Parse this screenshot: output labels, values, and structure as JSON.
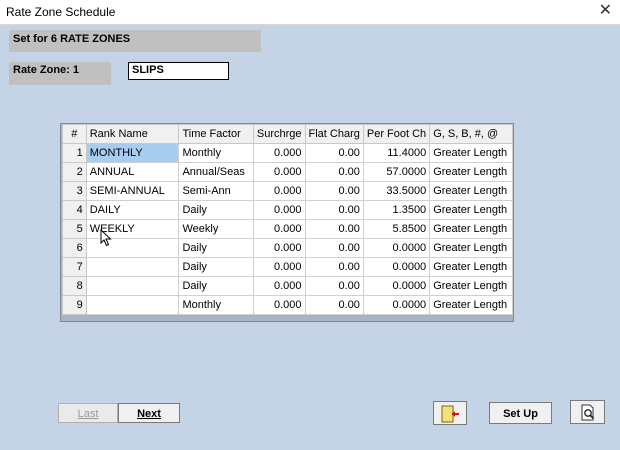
{
  "window": {
    "title": "Rate Zone Schedule",
    "close_glyph": "✕"
  },
  "header": {
    "set_label": "Set for 6 RATE ZONES",
    "rate_zone_label": "Rate Zone:  1",
    "zone_name_value": "SLIPS"
  },
  "grid": {
    "columns": [
      "#",
      "Rank Name",
      "Time Factor",
      "Surchrge",
      "Flat Charg",
      "Per Foot Ch",
      "G, S, B, #, @"
    ],
    "rows": [
      {
        "n": "1",
        "rank": "MONTHLY",
        "factor": "Monthly",
        "surcharge": "0.000",
        "flat": "0.00",
        "perfoot": "11.4000",
        "type": "Greater Length"
      },
      {
        "n": "2",
        "rank": "ANNUAL",
        "factor": "Annual/Seas",
        "surcharge": "0.000",
        "flat": "0.00",
        "perfoot": "57.0000",
        "type": "Greater Length"
      },
      {
        "n": "3",
        "rank": "SEMI-ANNUAL",
        "factor": "Semi-Ann",
        "surcharge": "0.000",
        "flat": "0.00",
        "perfoot": "33.5000",
        "type": "Greater Length"
      },
      {
        "n": "4",
        "rank": "DAILY",
        "factor": "Daily",
        "surcharge": "0.000",
        "flat": "0.00",
        "perfoot": "1.3500",
        "type": "Greater Length"
      },
      {
        "n": "5",
        "rank": "WEEKLY",
        "factor": "Weekly",
        "surcharge": "0.000",
        "flat": "0.00",
        "perfoot": "5.8500",
        "type": "Greater Length"
      },
      {
        "n": "6",
        "rank": "",
        "factor": "Daily",
        "surcharge": "0.000",
        "flat": "0.00",
        "perfoot": "0.0000",
        "type": "Greater Length"
      },
      {
        "n": "7",
        "rank": "",
        "factor": "Daily",
        "surcharge": "0.000",
        "flat": "0.00",
        "perfoot": "0.0000",
        "type": "Greater Length"
      },
      {
        "n": "8",
        "rank": "",
        "factor": "Daily",
        "surcharge": "0.000",
        "flat": "0.00",
        "perfoot": "0.0000",
        "type": "Greater Length"
      },
      {
        "n": "9",
        "rank": "",
        "factor": "Monthly",
        "surcharge": "0.000",
        "flat": "0.00",
        "perfoot": "0.0000",
        "type": "Greater Length"
      }
    ]
  },
  "buttons": {
    "last": "Last",
    "next": "Next",
    "exit_icon": "exit-door-icon",
    "setup": "Set Up",
    "preview_icon": "print-preview-icon"
  },
  "colors": {
    "client_bg": "#c4d3e6",
    "selection": "#a8cdf0",
    "label_bg": "#c0c0c0"
  }
}
